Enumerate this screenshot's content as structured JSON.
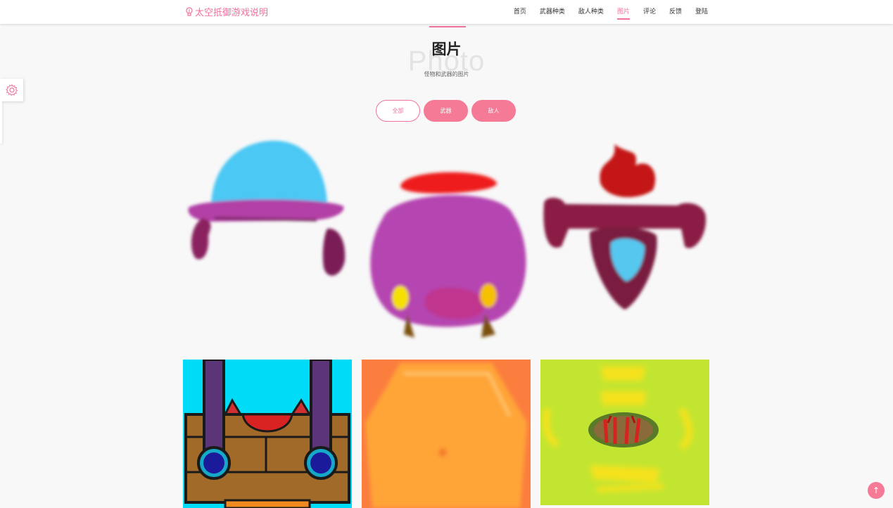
{
  "header": {
    "brand": "太空抵御游戏说明",
    "nav": [
      {
        "label": "首页",
        "active": false
      },
      {
        "label": "武器种类",
        "active": false
      },
      {
        "label": "敌人种类",
        "active": false
      },
      {
        "label": "图片",
        "active": true
      },
      {
        "label": "评论",
        "active": false
      },
      {
        "label": "反馈",
        "active": false
      },
      {
        "label": "登陆",
        "active": false
      }
    ]
  },
  "section": {
    "title": "图片",
    "background_word": "Photo",
    "subtitle": "怪物和武器的图片"
  },
  "filters": [
    {
      "label": "全部",
      "selected": true
    },
    {
      "label": "武器",
      "selected": false
    },
    {
      "label": "敌人",
      "selected": false
    }
  ],
  "gallery": [
    {
      "name": "blue-dome-weapon-image"
    },
    {
      "name": "purple-pot-enemy-image"
    },
    {
      "name": "maroon-torch-weapon-image"
    },
    {
      "name": "brown-crate-robot-image"
    },
    {
      "name": "orange-hexagon-image"
    },
    {
      "name": "lime-bug-image"
    }
  ],
  "back_to_top": "↑",
  "colors": {
    "accent": "#f0739a",
    "button": "#f47a96",
    "background": "#f8f8f8"
  },
  "icons": {
    "brand": "lightbulb-icon",
    "settings": "gear-icon"
  }
}
